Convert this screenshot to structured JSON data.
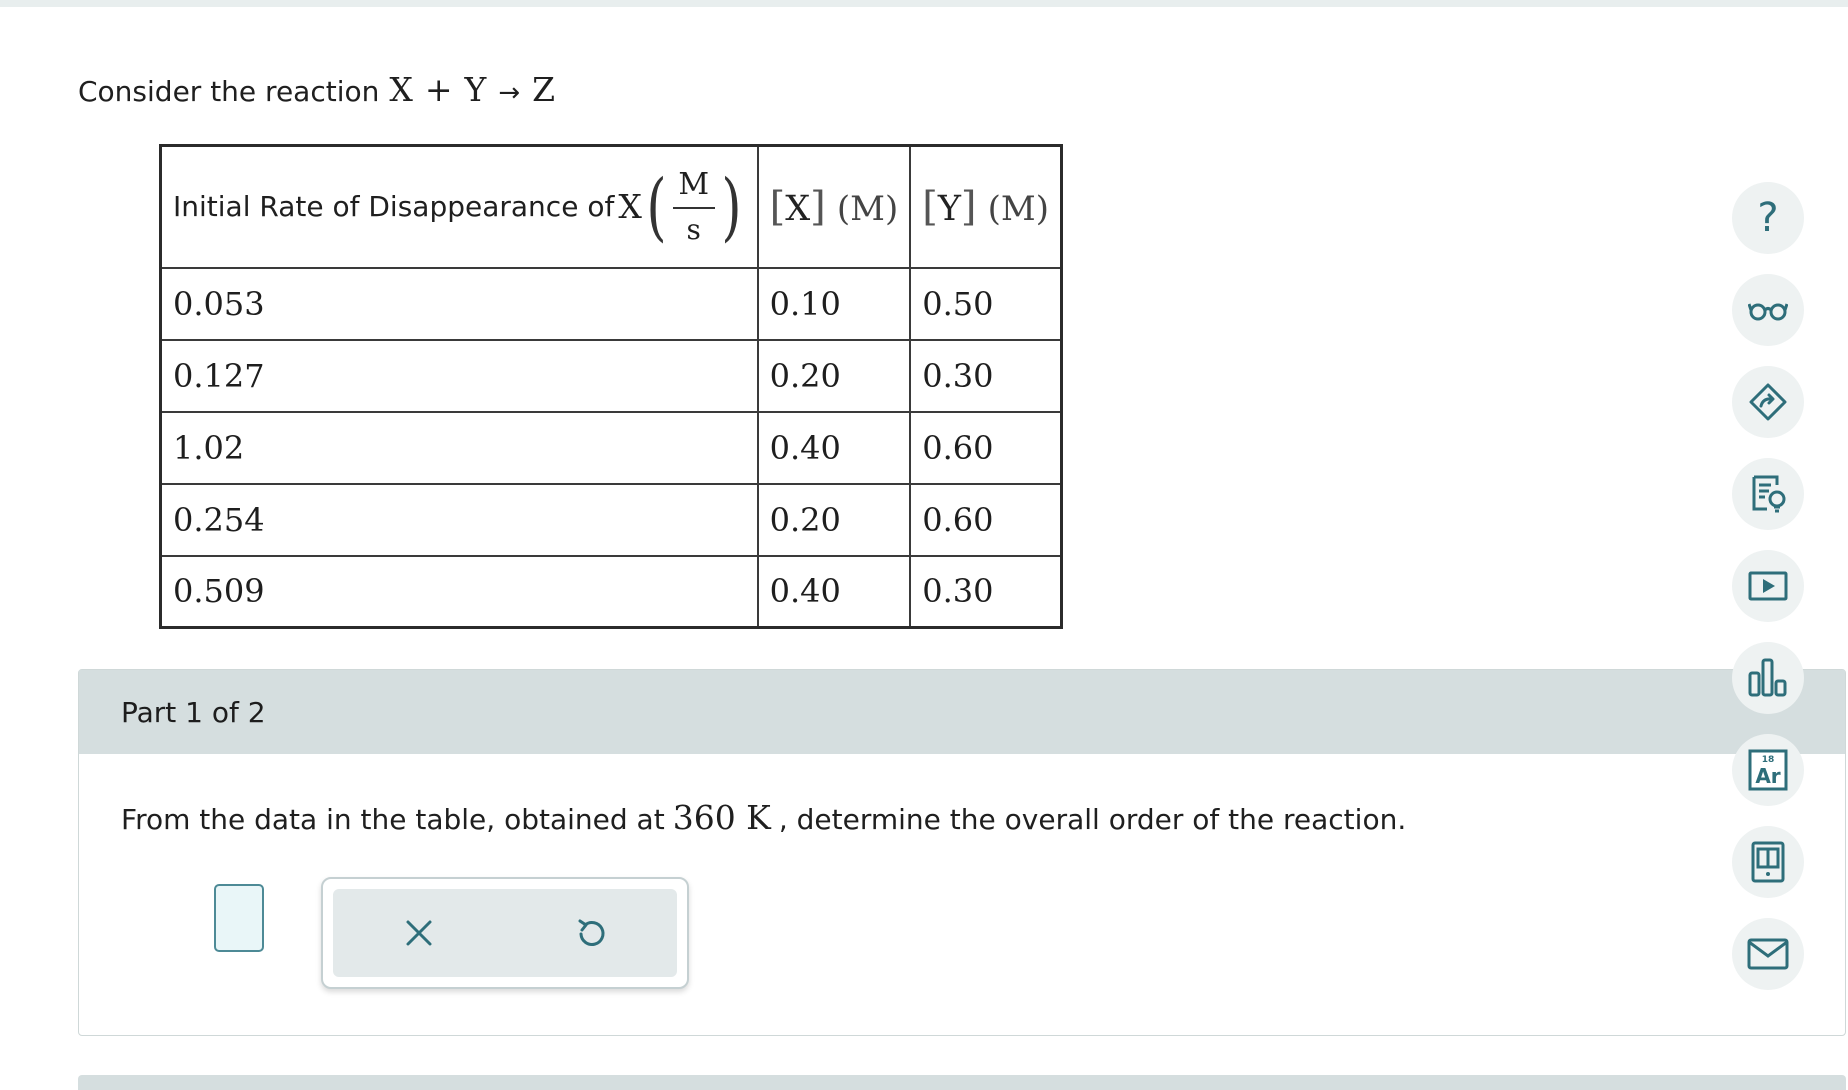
{
  "question": {
    "prefix": "Consider the reaction",
    "reactant1": "X",
    "plus": "+",
    "reactant2": "Y",
    "arrow": "→",
    "product": "Z"
  },
  "table": {
    "header": {
      "rate_label": "Initial Rate of Disappearance of",
      "rate_species": "X",
      "rate_unit_num": "M",
      "rate_unit_den": "s",
      "col2_species": "X",
      "col2_unit": "(M)",
      "col3_species": "Y",
      "col3_unit": "(M)"
    },
    "rows": [
      [
        "0.053",
        "0.10",
        "0.50"
      ],
      [
        "0.127",
        "0.20",
        "0.30"
      ],
      [
        "1.02",
        "0.40",
        "0.60"
      ],
      [
        "0.254",
        "0.20",
        "0.60"
      ],
      [
        "0.509",
        "0.40",
        "0.30"
      ]
    ]
  },
  "part": {
    "title": "Part 1 of 2",
    "text_before": "From the data in the table, obtained at",
    "temperature": "360 K",
    "text_after": ", determine the overall order of the reaction."
  },
  "tools": {
    "clear_icon": "close-icon",
    "undo_icon": "undo-icon"
  },
  "sidebar": {
    "items": [
      {
        "icon": "help-icon",
        "label": "?"
      },
      {
        "icon": "glasses-icon"
      },
      {
        "icon": "hint-tag-icon"
      },
      {
        "icon": "notes-lightbulb-icon"
      },
      {
        "icon": "video-play-icon"
      },
      {
        "icon": "bar-chart-icon"
      },
      {
        "icon": "periodic-table-icon",
        "number": "18",
        "symbol": "Ar"
      },
      {
        "icon": "ebook-icon"
      },
      {
        "icon": "mail-icon"
      }
    ]
  },
  "colors": {
    "accent": "#2e6e7a",
    "part_header_bg": "#d5dedf",
    "answer_box_border": "#4d8a96",
    "answer_box_bg": "#e9f6f8"
  }
}
